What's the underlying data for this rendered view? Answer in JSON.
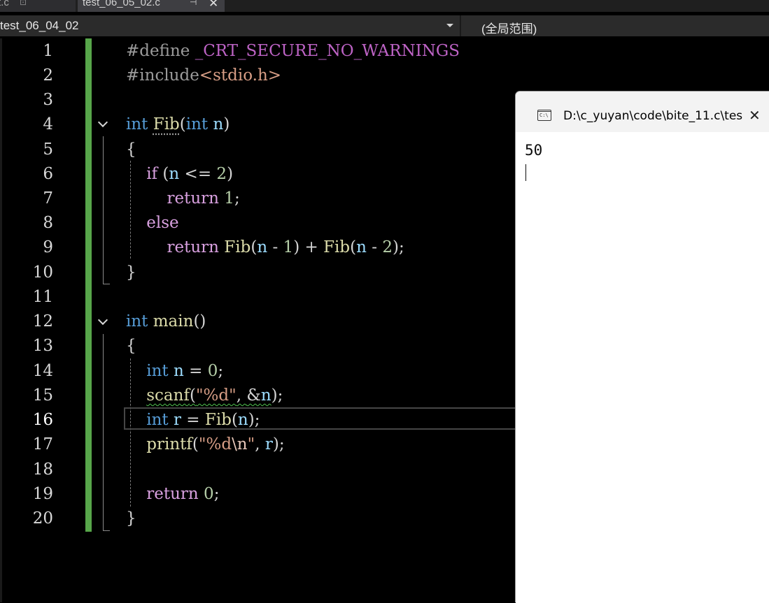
{
  "tabs": [
    {
      "label": "t.c",
      "active": false
    },
    {
      "label": "test_06_05_02.c",
      "active": true
    }
  ],
  "navbar": {
    "project": "test_06_04_02",
    "scope": "(全局范围)"
  },
  "editor": {
    "current_line": 16,
    "line_numbers": [
      "1",
      "2",
      "3",
      "4",
      "5",
      "6",
      "7",
      "8",
      "9",
      "10",
      "11",
      "12",
      "13",
      "14",
      "15",
      "16",
      "17",
      "18",
      "19",
      "20"
    ],
    "code": {
      "l1": {
        "directive": "#define",
        "macro": "_CRT_SECURE_NO_WARNINGS"
      },
      "l2": {
        "directive": "#include",
        "header": "<stdio.h>"
      },
      "l4": {
        "type": "int",
        "name": "Fib",
        "open": "(",
        "ptype": "int",
        "param": "n",
        "close": ")"
      },
      "l5": {
        "brace": "{"
      },
      "l6": {
        "kw": "if",
        "open": " (",
        "var": "n",
        "op": " <= ",
        "num": "2",
        "close": ")"
      },
      "l7": {
        "kw": "return",
        "num": "1",
        "end": ";"
      },
      "l8": {
        "kw": "else"
      },
      "l9": {
        "kw": "return",
        "fn1": "Fib",
        "o1": "(",
        "v1": "n",
        "m1": " - ",
        "n1": "1",
        "c1": ")",
        "plus": " + ",
        "fn2": "Fib",
        "o2": "(",
        "v2": "n",
        "m2": " - ",
        "n2": "2",
        "c2": ");"
      },
      "l10": {
        "brace": "}"
      },
      "l12": {
        "type": "int",
        "name": "main",
        "parens": "()"
      },
      "l13": {
        "brace": "{"
      },
      "l14": {
        "type": "int",
        "var": "n",
        "eq": " = ",
        "num": "0",
        "end": ";"
      },
      "l15": {
        "fn": "scanf",
        "open": "(",
        "str": "\"%d\"",
        "comma": ", ",
        "amp": "&",
        "var": "n",
        "end": ");"
      },
      "l16": {
        "type": "int",
        "var": "r",
        "eq": " = ",
        "fn": "Fib",
        "open": "(",
        "arg": "n",
        "end": ");"
      },
      "l17": {
        "fn": "printf",
        "open": "(",
        "str1": "\"%d",
        "esc": "\\n",
        "str2": "\"",
        "comma": ", ",
        "var": "r",
        "end": ");"
      },
      "l19": {
        "kw": "return",
        "num": "0",
        "end": ";"
      },
      "l20": {
        "brace": "}"
      }
    }
  },
  "console": {
    "title": "D:\\c_yuyan\\code\\bite_11.c\\tes",
    "icon_text": "C:\\",
    "output": "50"
  },
  "colors": {
    "keyword": "#569cd6",
    "control": "#d8a0df",
    "function": "#dcdcaa",
    "number": "#b5cea8",
    "string": "#d69d85",
    "variable": "#9cdcfe",
    "change_bar": "#57a64a"
  }
}
